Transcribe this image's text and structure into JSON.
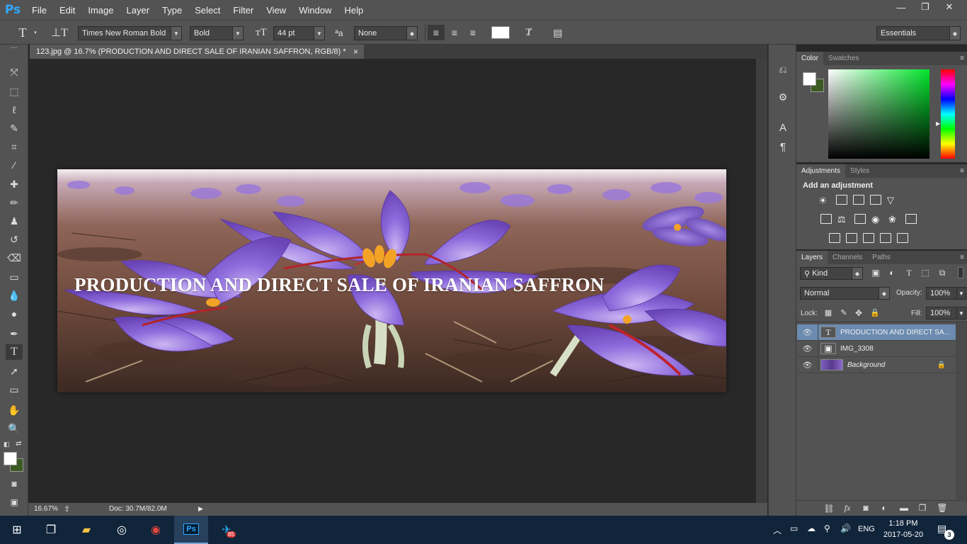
{
  "app": {
    "logo": "Ps"
  },
  "menu": [
    "File",
    "Edit",
    "Image",
    "Layer",
    "Type",
    "Select",
    "Filter",
    "View",
    "Window",
    "Help"
  ],
  "window_controls": {
    "minimize": "—",
    "restore": "❐",
    "close": "✕"
  },
  "options": {
    "font_family": "Times New Roman Bold",
    "font_style": "Bold",
    "font_size": "44 pt",
    "aa_label": "ªa",
    "anti_alias": "None",
    "text_color": "#ffffff",
    "workspace": "Essentials"
  },
  "document": {
    "tab_title": "123.jpg @ 16.7% (PRODUCTION AND DIRECT SALE OF IRANIAN SAFFRON, RGB/8) *",
    "close": "×",
    "banner_text": "PRODUCTION AND DIRECT SALE OF IRANIAN SAFFRON"
  },
  "status": {
    "zoom": "16.67%",
    "doc": "Doc: 30.7M/82.0M"
  },
  "color_panel": {
    "tabs": [
      "Color",
      "Swatches"
    ],
    "foreground": "#ffffff",
    "background": "#3c5a22"
  },
  "adjustments_panel": {
    "tabs": [
      "Adjustments",
      "Styles"
    ],
    "heading": "Add an adjustment"
  },
  "layers_panel": {
    "tabs": [
      "Layers",
      "Channels",
      "Paths"
    ],
    "filter_kind": "Kind",
    "blend_mode": "Normal",
    "opacity_label": "Opacity:",
    "opacity": "100%",
    "lock_label": "Lock:",
    "fill_label": "Fill:",
    "fill": "100%",
    "layers": [
      {
        "name": "PRODUCTION AND DIRECT SA...",
        "thumb": "T",
        "selected": true
      },
      {
        "name": "IMG_3308",
        "thumb": "▣",
        "selected": false
      },
      {
        "name": "Background",
        "thumb": "",
        "selected": false,
        "locked": true
      }
    ]
  },
  "taskbar": {
    "language": "ENG",
    "time": "1:18 PM",
    "date": "2017-05-20",
    "notification_count": "3",
    "telegram_badge": "85"
  },
  "colors": {
    "accent": "#31a8ff",
    "chrome": "#535353",
    "canvas": "#282828",
    "taskbar": "#10243a"
  }
}
